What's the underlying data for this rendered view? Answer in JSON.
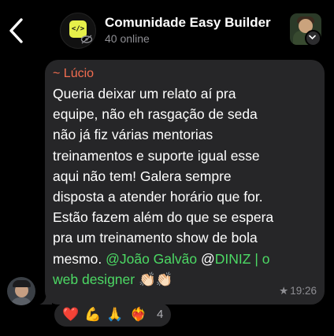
{
  "header": {
    "title": "Comunidade Easy Builder",
    "subtitle": "40 online",
    "group_avatar_icon": "code-bracket-icon",
    "muted_icon": "eye-slash-icon",
    "accent": "#e6f04a"
  },
  "message": {
    "sender": "~ Lúcio",
    "lines": [
      "Queria deixar um relato aí pra",
      "equipe, não eh rasgação de seda",
      "não já fiz várias mentorias",
      "treinamentos e suporte igual esse",
      "aqui não tem! Galera sempre",
      "disposta a atender horário que for.",
      "Estão fazem além do que se espera",
      "pra um treinamento show de bola"
    ],
    "line9_prefix": "mesmo. ",
    "mention1": "@João Galvão",
    "mention2_prefix": "@",
    "mention2_name": "DINIZ | o",
    "mention2_cont": "web designer",
    "trailing_emoji": " 👏🏻👏🏻",
    "star": "★",
    "time": "19:26"
  },
  "reactions": {
    "emojis": [
      "❤️",
      "💪",
      "🙏",
      "❤️‍🔥"
    ],
    "count": "4"
  },
  "colors": {
    "sender_name": "#f26d50",
    "mention": "#4cd964",
    "bubble": "#262628"
  }
}
